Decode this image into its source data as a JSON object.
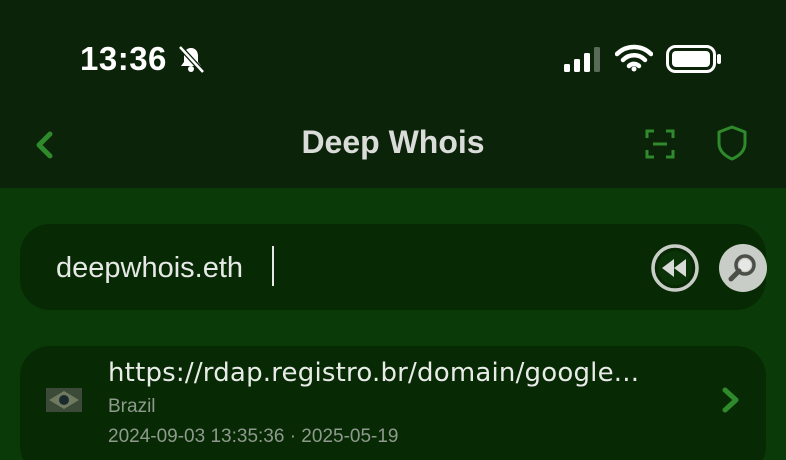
{
  "status_bar": {
    "time": "13:36",
    "icons": [
      "bell-slash-icon",
      "signal-icon",
      "wifi-icon",
      "battery-icon"
    ]
  },
  "nav": {
    "title": "Deep Whois",
    "back_icon": "chevron-left-icon",
    "actions": [
      "scan-icon",
      "shield-icon"
    ]
  },
  "search": {
    "value": "deepwhois.eth",
    "buttons": [
      "rewind-icon",
      "magnifier-icon"
    ]
  },
  "results": [
    {
      "url": "https://rdap.registro.br/domain/google...",
      "country": "Brazil",
      "dates": "2024-09-03 13:35:36 · 2025-05-19",
      "flag_icon": "brazil-flag-icon"
    }
  ],
  "colors": {
    "background": "#0b2309",
    "content_background": "#093a07",
    "card_background": "#072a05",
    "accent_green": "#2e8a2a",
    "muted_text": "#8e9a8c"
  }
}
